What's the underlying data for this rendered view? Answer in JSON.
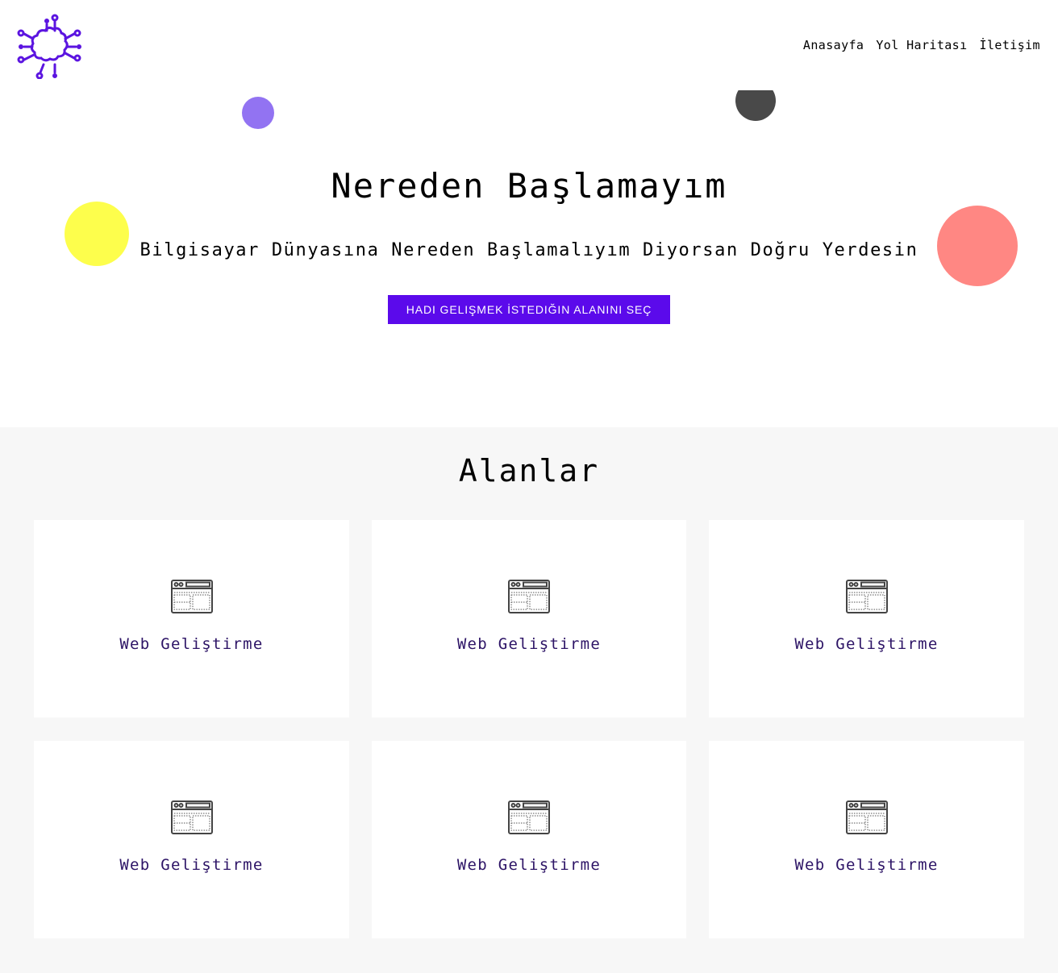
{
  "header": {
    "logo_icon": "brain-circuit-icon",
    "nav": [
      {
        "label": "Anasayfa"
      },
      {
        "label": "Yol Haritası"
      },
      {
        "label": "İletişim"
      }
    ]
  },
  "hero": {
    "title": "Nereden Başlamayım",
    "subtitle": "Bilgisayar Dünyasına Nereden Başlamalıyım Diyorsan Doğru Yerdesin",
    "cta_label": "HADI GELIŞMEK İSTEDIĞIN ALANINI SEÇ",
    "decor_colors": [
      "#9273f2",
      "#494949",
      "#fdfe4c",
      "#ff8783"
    ]
  },
  "areas": {
    "title": "Alanlar",
    "cards": [
      {
        "label": "Web Geliştirme",
        "icon": "browser-window-icon"
      },
      {
        "label": "Web Geliştirme",
        "icon": "browser-window-icon"
      },
      {
        "label": "Web Geliştirme",
        "icon": "browser-window-icon"
      },
      {
        "label": "Web Geliştirme",
        "icon": "browser-window-icon"
      },
      {
        "label": "Web Geliştirme",
        "icon": "browser-window-icon"
      },
      {
        "label": "Web Geliştirme",
        "icon": "browser-window-icon"
      }
    ]
  },
  "colors": {
    "accent": "#5b0aeb",
    "card_text": "#2d1466",
    "section_bg": "#f7f7f7"
  }
}
